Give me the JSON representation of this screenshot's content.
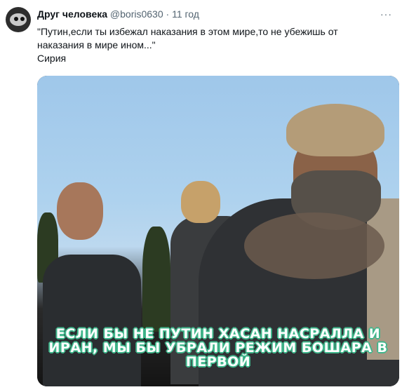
{
  "tweet": {
    "author_name": "Друг человека",
    "author_handle": "@boris0630",
    "separator": "·",
    "time": "11 год",
    "more_icon": "···",
    "text_lines": [
      "\"Путин,если ты избежал наказания в этом мире,то не убежишь от",
      "наказания в мире ином...\"",
      "Сирия"
    ]
  },
  "media": {
    "caption_lines": [
      "ЕСЛИ БЫ НЕ ПУТИН  ХАСАН НАСРАЛЛА  И",
      "ИРАН, МЫ БЫ УБРАЛИ РЕЖИМ БОШАРА В",
      "ПЕРВОЙ"
    ]
  }
}
